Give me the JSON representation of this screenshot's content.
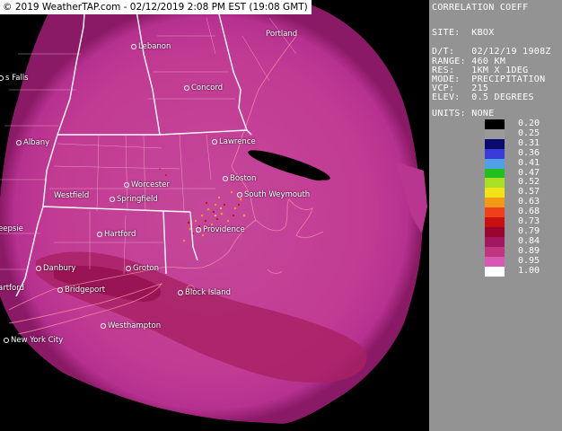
{
  "timestamp": "© 2019 WeatherTAP.com - 02/12/2019 2:08 PM EST (19:08 GMT)",
  "panel": {
    "title": "CORRELATION COEFF",
    "site": "SITE:  KBOX",
    "dt": "D/T:   02/12/19 1908Z",
    "range": "RANGE: 460 KM",
    "res": "RES:   1KM X 1DEG",
    "mode": "MODE:  PRECIPITATION",
    "vcp": "VCP:   215",
    "elev": "ELEV:  0.5 DEGREES",
    "units": "UNITS: NONE"
  },
  "legend": [
    {
      "label": "0.20",
      "color": "#000000"
    },
    {
      "label": "0.25",
      "color": "#9a9a9a"
    },
    {
      "label": "0.31",
      "color": "#0a0a6e"
    },
    {
      "label": "0.36",
      "color": "#3b3bd9"
    },
    {
      "label": "0.41",
      "color": "#4fa0e6"
    },
    {
      "label": "0.47",
      "color": "#1fbf1f"
    },
    {
      "label": "0.52",
      "color": "#a8e028"
    },
    {
      "label": "0.57",
      "color": "#f2e316"
    },
    {
      "label": "0.63",
      "color": "#f29a16"
    },
    {
      "label": "0.68",
      "color": "#f0401a"
    },
    {
      "label": "0.73",
      "color": "#c81010"
    },
    {
      "label": "0.79",
      "color": "#9a0530"
    },
    {
      "label": "0.84",
      "color": "#a21860"
    },
    {
      "label": "0.89",
      "color": "#c0357f"
    },
    {
      "label": "0.95",
      "color": "#d858b6"
    },
    {
      "label": "1.00",
      "color": "#ffffff"
    }
  ],
  "cities": [
    {
      "name": "Lebanon",
      "dot": true
    },
    {
      "name": "Portland",
      "dot": false
    },
    {
      "name": "s Falls",
      "dot": true
    },
    {
      "name": "Concord",
      "dot": true
    },
    {
      "name": "Albany",
      "dot": true
    },
    {
      "name": "Lawrence",
      "dot": true
    },
    {
      "name": "Boston",
      "dot": true
    },
    {
      "name": "Worcester",
      "dot": true
    },
    {
      "name": "Westfield",
      "dot": false
    },
    {
      "name": "Springfield",
      "dot": true
    },
    {
      "name": "South Weymouth",
      "dot": true
    },
    {
      "name": "Hartford",
      "dot": true
    },
    {
      "name": "Providence",
      "dot": true
    },
    {
      "name": "eepsie",
      "dot": false
    },
    {
      "name": "Danbury",
      "dot": true
    },
    {
      "name": "Groton",
      "dot": true
    },
    {
      "name": "artford",
      "dot": false
    },
    {
      "name": "Bridgeport",
      "dot": true
    },
    {
      "name": "Block Island",
      "dot": true
    },
    {
      "name": "Westhampton",
      "dot": true
    },
    {
      "name": "New York City",
      "dot": true
    }
  ],
  "colors": {
    "echo_main": "#c53f95",
    "echo_dense": "#9a1656",
    "background": "#000000",
    "panel": "#939393"
  }
}
